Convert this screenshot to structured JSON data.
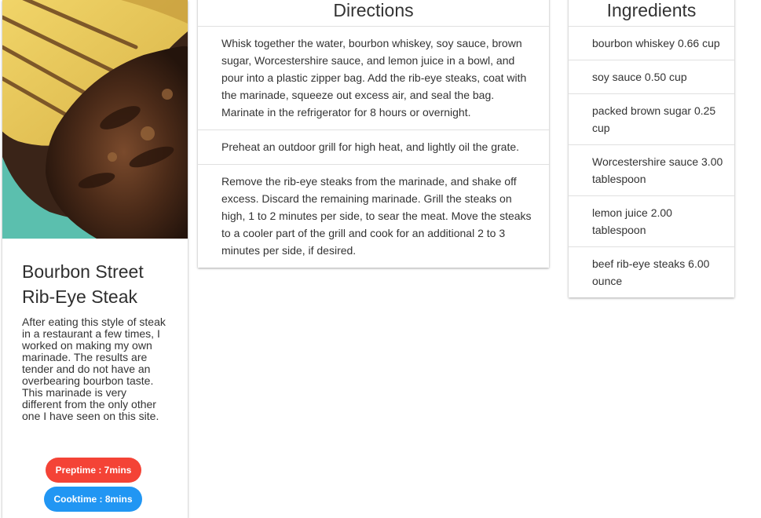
{
  "recipe": {
    "title": "Bourbon Street Rib-Eye Steak",
    "description": "After eating this style of steak in a restaurant a few times, I worked on making my own marinade. The results are tender and do not have an overbearing bourbon taste. This marinade is very different from the only other one I have seen on this site.",
    "preptime": "Preptime : 7mins",
    "cooktime": "Cooktime : 8mins"
  },
  "directions": {
    "heading": "Directions",
    "steps": [
      "Whisk together the water, bourbon whiskey, soy sauce, brown sugar, Worcestershire sauce, and lemon juice in a bowl, and pour into a plastic zipper bag. Add the rib-eye steaks, coat with the marinade, squeeze out excess air, and seal the bag. Marinate in the refrigerator for 8 hours or overnight.",
      "Preheat an outdoor grill for high heat, and lightly oil the grate.",
      "Remove the rib-eye steaks from the marinade, and shake off excess. Discard the remaining marinade. Grill the steaks on high, 1 to 2 minutes per side, to sear the meat. Move the steaks to a cooler part of the grill and cook for an additional 2 to 3 minutes per side, if desired."
    ]
  },
  "ingredients": {
    "heading": "Ingredients",
    "items": [
      "bourbon whiskey 0.66 cup",
      "soy sauce 0.50 cup",
      "packed brown sugar 0.25 cup",
      "Worcestershire sauce 3.00 tablespoon",
      "lemon juice 2.00 tablespoon",
      "beef rib-eye steaks 6.00 ounce"
    ]
  },
  "colors": {
    "preptime_badge": "#f44336",
    "cooktime_badge": "#2196f3"
  }
}
